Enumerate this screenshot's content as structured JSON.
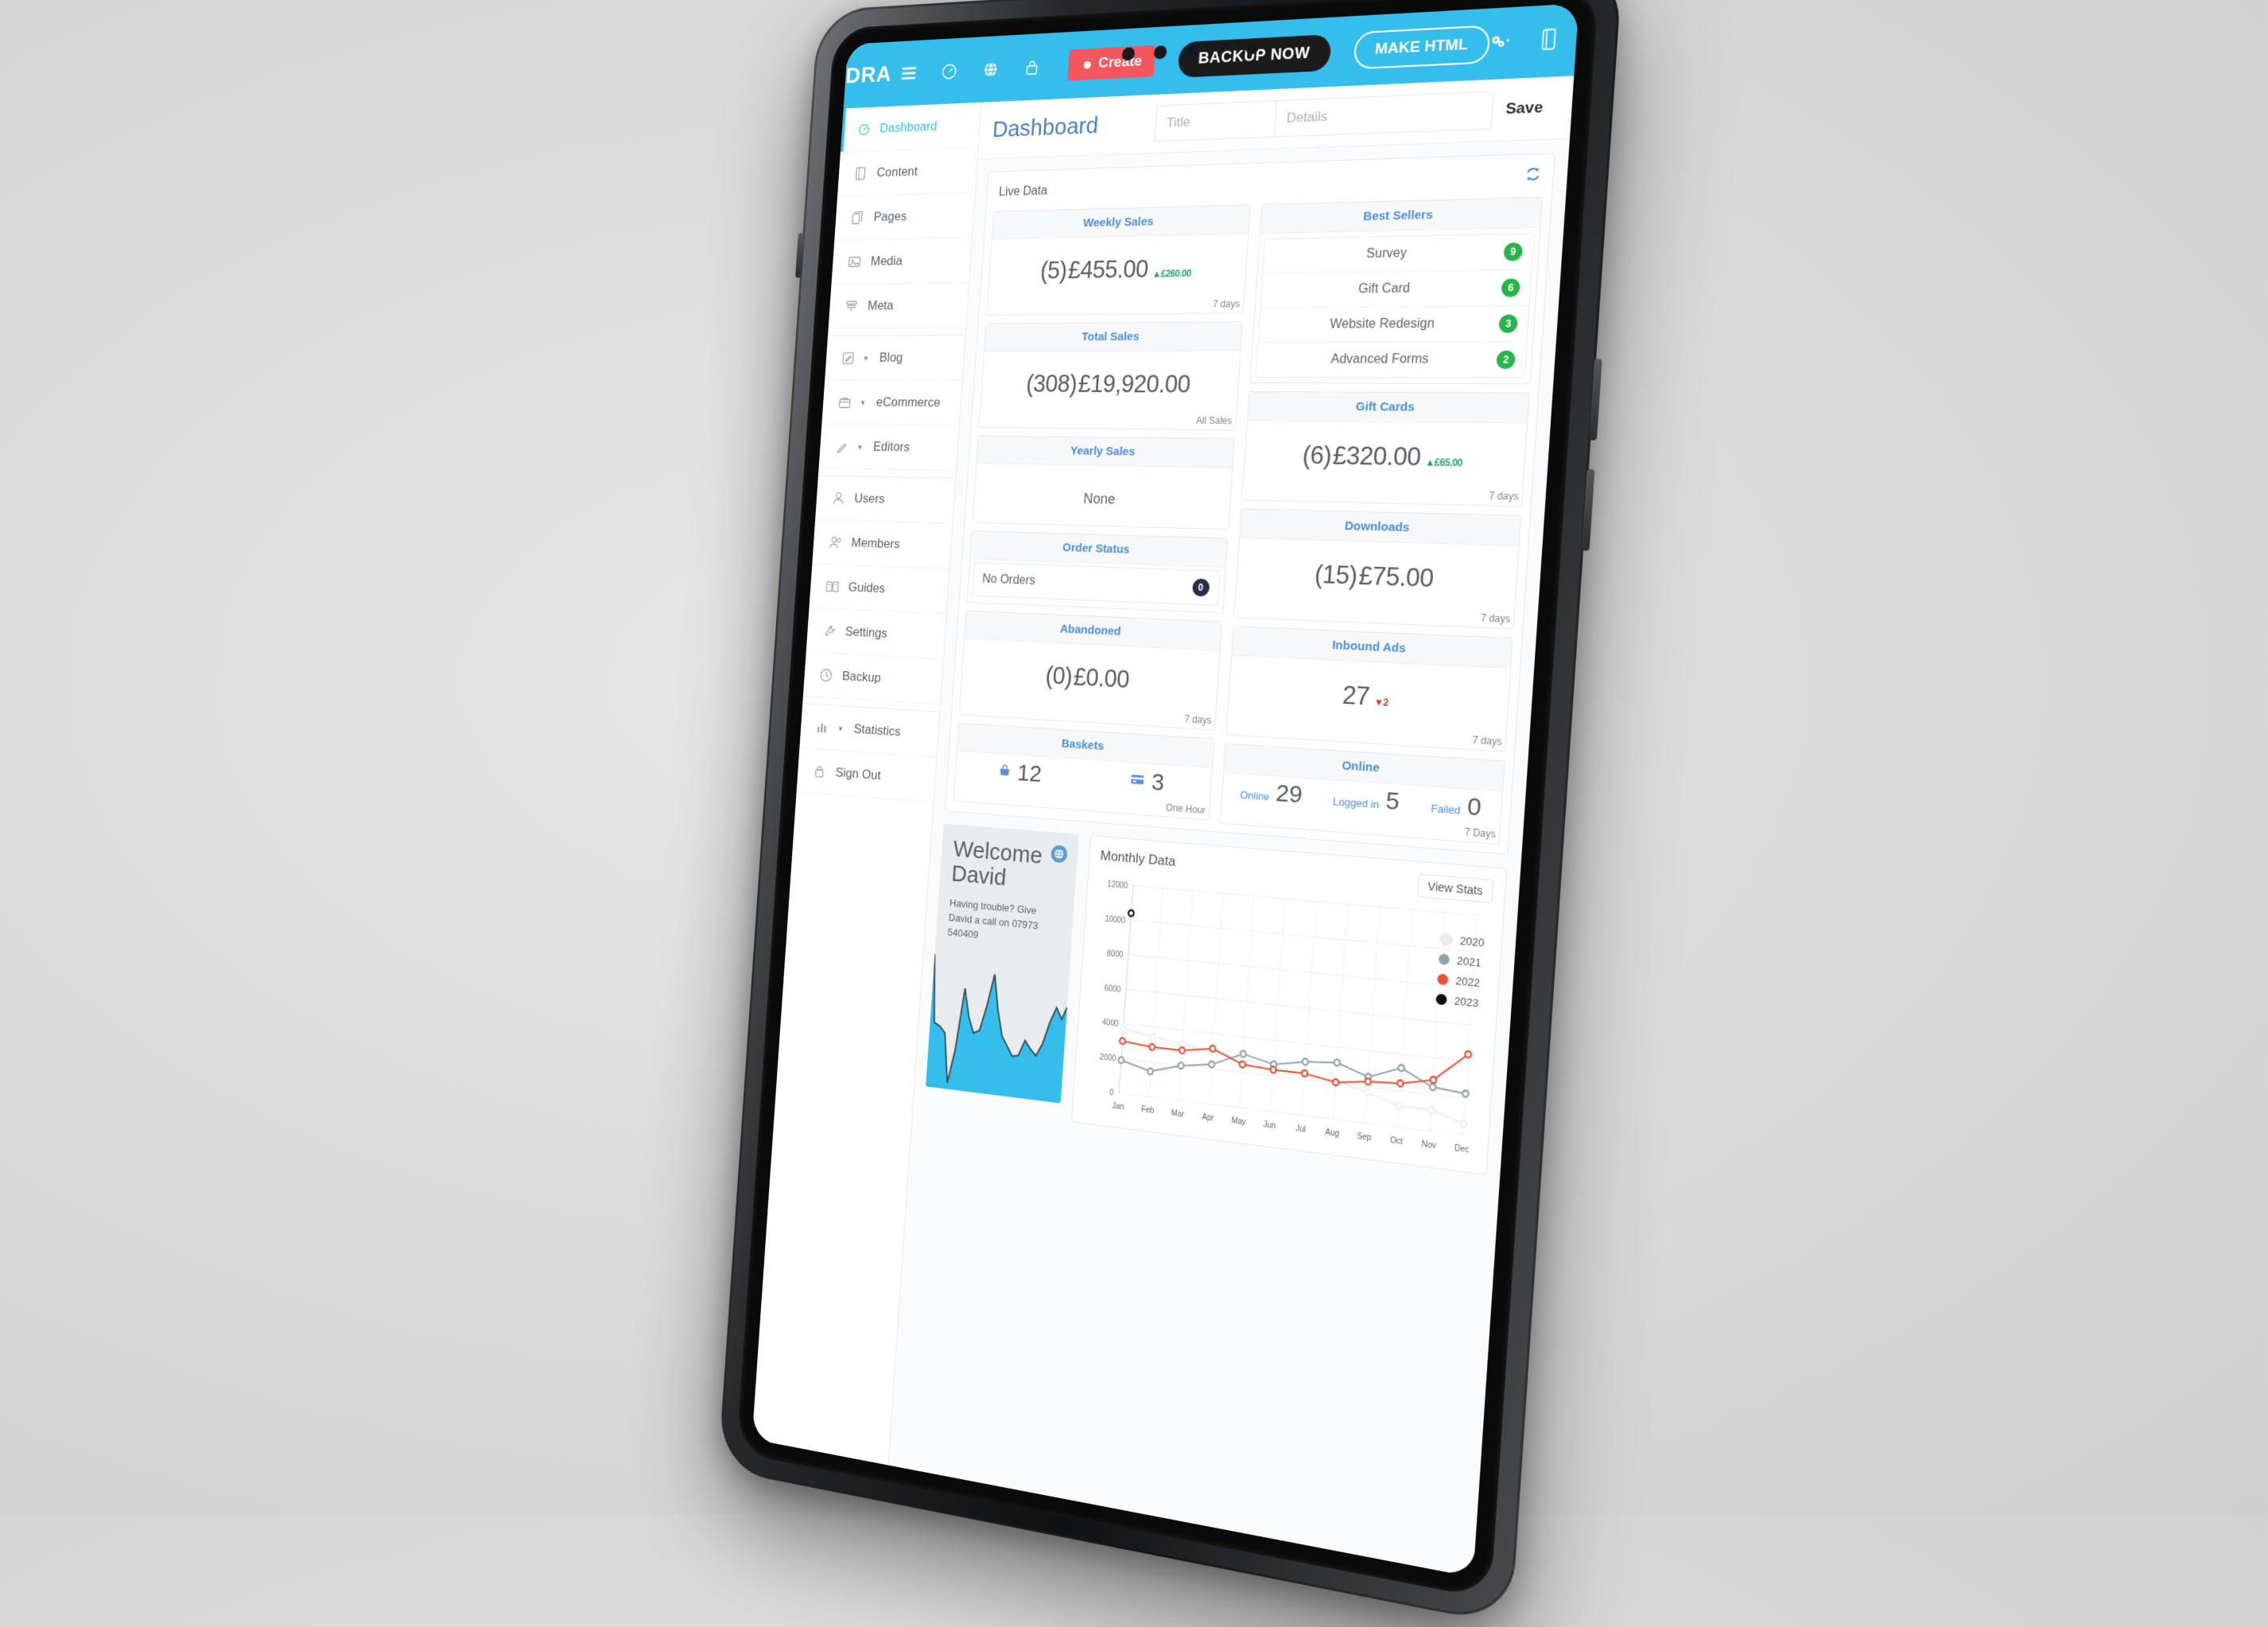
{
  "header": {
    "brand": "DRA",
    "nav_icons": [
      "menu-icon",
      "gauge-icon",
      "globe-icon",
      "lock-icon"
    ],
    "create_label": "Create",
    "backup_label": "BACKUP NOW",
    "make_html_label": "MAKE HTML",
    "right_icons": [
      "cogs-dropdown-icon",
      "panel-icon"
    ]
  },
  "sidebar": {
    "items": [
      {
        "label": "Dashboard",
        "icon": "gauge-icon",
        "active": true,
        "caret": false
      },
      {
        "label": "Content",
        "icon": "book-icon",
        "active": false,
        "caret": false
      },
      {
        "label": "Pages",
        "icon": "pages-icon",
        "active": false,
        "caret": false
      },
      {
        "label": "Media",
        "icon": "image-icon",
        "active": false,
        "caret": false
      },
      {
        "label": "Meta",
        "icon": "tag-icon",
        "active": false,
        "caret": false
      },
      {
        "label": "Blog",
        "icon": "edit-icon",
        "active": false,
        "caret": true
      },
      {
        "label": "eCommerce",
        "icon": "bag-icon",
        "active": false,
        "caret": true
      },
      {
        "label": "Editors",
        "icon": "pencil-icon",
        "active": false,
        "caret": true
      },
      {
        "label": "Users",
        "icon": "user-icon",
        "active": false,
        "caret": false
      },
      {
        "label": "Members",
        "icon": "members-icon",
        "active": false,
        "caret": false
      },
      {
        "label": "Guides",
        "icon": "guide-icon",
        "active": false,
        "caret": false
      },
      {
        "label": "Settings",
        "icon": "wrench-icon",
        "active": false,
        "caret": false
      },
      {
        "label": "Backup",
        "icon": "clock-icon",
        "active": false,
        "caret": false
      },
      {
        "label": "Statistics",
        "icon": "bars-icon",
        "active": false,
        "caret": true
      },
      {
        "label": "Sign Out",
        "icon": "lock-icon",
        "active": false,
        "caret": false
      }
    ]
  },
  "main": {
    "page_title": "Dashboard",
    "title_placeholder": "Title",
    "details_placeholder": "Details",
    "save_label": "Save",
    "panel_title": "Live Data",
    "refresh_icon": "refresh-icon"
  },
  "cards": {
    "weekly_sales": {
      "title": "Weekly Sales",
      "count": "(5)",
      "value": "£455.00",
      "delta": "£260.00",
      "delta_dir": "up",
      "footer": "7 days"
    },
    "total_sales": {
      "title": "Total Sales",
      "count": "(308)",
      "value": "£19,920.00",
      "footer": "All Sales"
    },
    "yearly_sales": {
      "title": "Yearly Sales",
      "value": "None"
    },
    "order_status": {
      "title": "Order Status",
      "label": "No Orders",
      "badge": "0"
    },
    "abandoned": {
      "title": "Abandoned",
      "count": "(0)",
      "value": "£0.00",
      "footer": "7 days"
    },
    "baskets": {
      "title": "Baskets",
      "basket_icon": "basket-icon",
      "basket_count": "12",
      "card_icon": "credit-card-icon",
      "card_count": "3",
      "footer": "One Hour"
    },
    "best_sellers": {
      "title": "Best Sellers",
      "rows": [
        {
          "name": "Survey",
          "count": "9"
        },
        {
          "name": "Gift Card",
          "count": "6"
        },
        {
          "name": "Website Redesign",
          "count": "3"
        },
        {
          "name": "Advanced Forms",
          "count": "2"
        }
      ]
    },
    "gift_cards": {
      "title": "Gift Cards",
      "count": "(6)",
      "value": "£320.00",
      "delta": "£65.00",
      "delta_dir": "up",
      "footer": "7 days"
    },
    "downloads": {
      "title": "Downloads",
      "count": "(15)",
      "value": "£75.00",
      "footer": "7 days"
    },
    "inbound_ads": {
      "title": "Inbound Ads",
      "value": "27",
      "delta": "2",
      "delta_dir": "down",
      "footer": "7 days"
    },
    "online": {
      "title": "Online",
      "metrics": [
        {
          "label": "Online",
          "value": "29"
        },
        {
          "label": "Logged in",
          "value": "5"
        },
        {
          "label": "Failed",
          "value": "0"
        }
      ],
      "footer": "7 Days"
    }
  },
  "welcome": {
    "greeting": "Welcome",
    "name": "David",
    "message": "Having trouble? Give David a call on 07973 540409",
    "icon": "globe-icon"
  },
  "chart_panel": {
    "title": "Monthly Data",
    "view_stats_label": "View Stats"
  },
  "chart_data": {
    "type": "line",
    "title": "Monthly Data",
    "xlabel": "",
    "ylabel": "",
    "ylim": [
      0,
      12000
    ],
    "yticks": [
      0,
      2000,
      4000,
      6000,
      8000,
      10000,
      12000
    ],
    "grid": true,
    "legend_position": "right",
    "categories": [
      "Jan",
      "Feb",
      "Mar",
      "Apr",
      "May",
      "Jun",
      "Jul",
      "Aug",
      "Sep",
      "Oct",
      "Nov",
      "Dec"
    ],
    "series": [
      {
        "name": "2020",
        "color": "#eceff1",
        "values": [
          3700,
          3450,
          3200,
          3000,
          2750,
          2500,
          2300,
          2100,
          1700,
          1150,
          1150,
          600
        ]
      },
      {
        "name": "2021",
        "color": "#8fa3ad",
        "values": [
          1900,
          1450,
          1980,
          2250,
          3050,
          2650,
          3000,
          3150,
          2550,
          3250,
          2400,
          2250
        ]
      },
      {
        "name": "2022",
        "color": "#e8523a",
        "values": [
          3000,
          2850,
          2850,
          3150,
          2450,
          2350,
          2350,
          2050,
          2300,
          2400,
          2800,
          4400
        ]
      },
      {
        "name": "2023",
        "color": "#0d0d0d",
        "values": [
          10400,
          null,
          null,
          null,
          null,
          null,
          null,
          null,
          null,
          null,
          null,
          null
        ]
      }
    ]
  }
}
